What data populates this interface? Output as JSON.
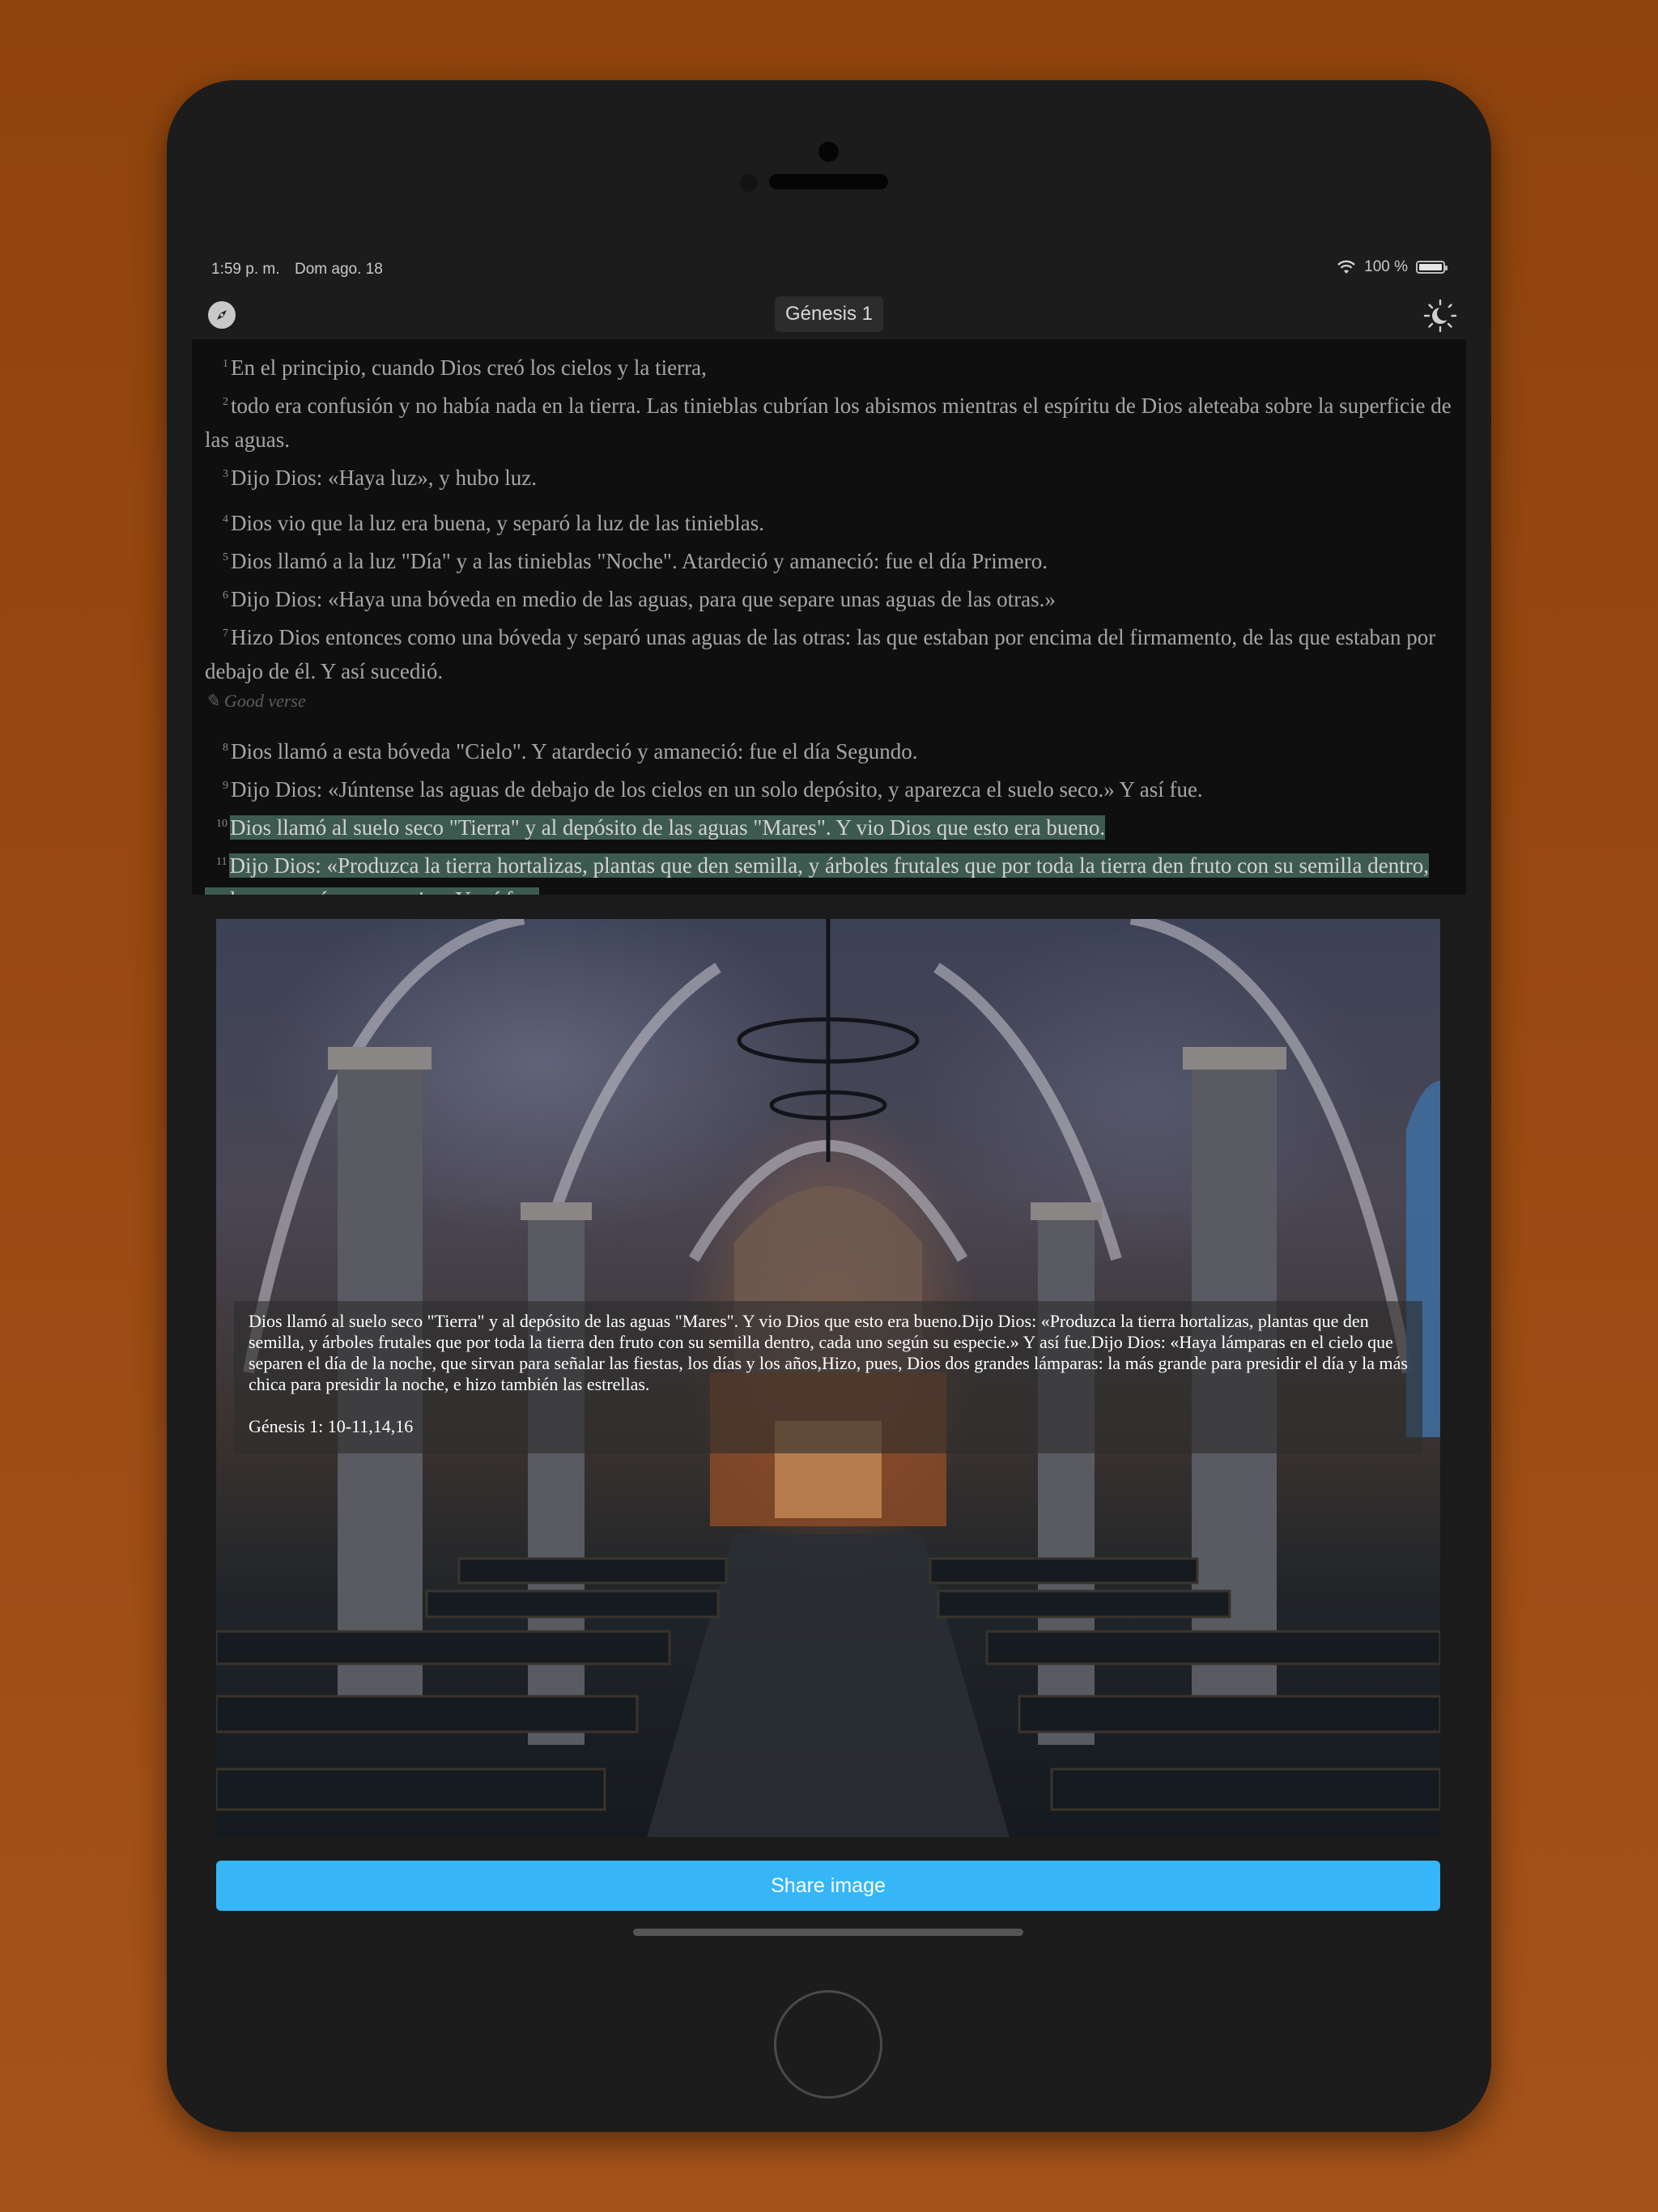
{
  "status_bar": {
    "time": "1:59 p. m.",
    "date": "Dom ago. 18",
    "battery": "100 %",
    "wifi_icon": "wifi-icon",
    "battery_level": 1.0
  },
  "nav": {
    "title": "Génesis 1",
    "left_icon": "compass-icon",
    "right_icon": "theme-toggle-icon"
  },
  "verses": [
    {
      "num": "1",
      "text": "En el principio, cuando Dios creó los cielos y la tierra,"
    },
    {
      "num": "2",
      "text": "todo era confusión y no había nada en la tierra. Las tinieblas cubrían los abismos mientras el espíritu de Dios aleteaba sobre la superficie de las aguas."
    },
    {
      "num": "3",
      "text": "Dijo Dios: «Haya luz», y hubo luz."
    },
    {
      "num": "4",
      "text": "Dios vio que la luz era buena, y separó la luz de las tinieblas."
    },
    {
      "num": "5",
      "text": "Dios llamó a la luz \"Día\" y a las tinieblas \"Noche\". Atardeció y amaneció: fue el día Primero."
    },
    {
      "num": "6",
      "text": "Dijo Dios: «Haya una bóveda en medio de las aguas, para que separe unas aguas de las otras.»"
    },
    {
      "num": "7",
      "text": "Hizo Dios entonces como una bóveda y separó unas aguas de las otras: las que estaban por encima del firmamento, de las que estaban por debajo de él. Y así sucedió."
    },
    {
      "num": "8",
      "text": "Dios llamó a esta bóveda \"Cielo\". Y atardeció y amaneció: fue el día Segundo."
    },
    {
      "num": "9",
      "text": "Dijo Dios: «Júntense las aguas de debajo de los cielos en un solo depósito, y aparezca el suelo seco.» Y así fue."
    },
    {
      "num": "10",
      "text": "Dios llamó al suelo seco \"Tierra\" y al depósito de las aguas \"Mares\". Y vio Dios que esto era bueno."
    },
    {
      "num": "11",
      "text": "Dijo Dios: «Produzca la tierra hortalizas, plantas que den semilla, y árboles frutales que por toda la tierra den fruto con su semilla dentro, cada uno según su especie.» Y así fue."
    }
  ],
  "note": "✎ Good verse",
  "share": {
    "caption": "Dios llamó al suelo seco \"Tierra\" y al depósito de las aguas \"Mares\". Y vio Dios que esto era bueno.Dijo Dios: «Produzca la tierra hortalizas, plantas que den semilla, y árboles frutales que por toda la tierra den fruto con su semilla dentro, cada uno según su especie.» Y así fue.Dijo Dios: «Haya lámparas en el cielo que separen el día de la noche, que sirvan para señalar las fiestas, los días y los años,Hizo, pues, Dios dos grandes lámparas: la más grande para presidir el día y la más chica para presidir la noche, e hizo también las estrellas.",
    "reference": "Génesis 1: 10-11,14,16",
    "button_label": "Share image",
    "button_color": "#36b6f8",
    "highlight_color": "#3d5a50"
  }
}
